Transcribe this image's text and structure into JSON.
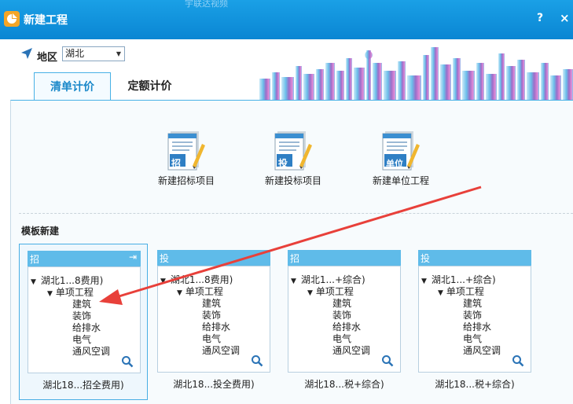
{
  "window": {
    "background_text": "宇联达视频",
    "title": "新建工程",
    "help": "?",
    "close": "×"
  },
  "region": {
    "label": "地区",
    "value": "湖北"
  },
  "tabs": [
    {
      "label": "清单计价",
      "active": true
    },
    {
      "label": "定额计价",
      "active": false
    }
  ],
  "actions": [
    {
      "badge": "招",
      "label": "新建招标项目",
      "icon": "bid-document-icon"
    },
    {
      "badge": "投",
      "label": "新建投标项目",
      "icon": "tender-document-icon"
    },
    {
      "badge": "单位",
      "label": "新建单位工程",
      "icon": "unit-document-icon"
    }
  ],
  "templates": {
    "title": "模板新建",
    "cards": [
      {
        "tag": "招",
        "root": "湖北1...8费用)",
        "sub": "单项工程",
        "items": [
          "建筑",
          "装饰",
          "给排水",
          "电气",
          "通风空调"
        ],
        "name": "湖北18...招全费用)"
      },
      {
        "tag": "投",
        "root": "湖北1...8费用)",
        "sub": "单项工程",
        "items": [
          "建筑",
          "装饰",
          "给排水",
          "电气",
          "通风空调"
        ],
        "name": "湖北18...投全费用)"
      },
      {
        "tag": "招",
        "root": "湖北1...+综合)",
        "sub": "单项工程",
        "items": [
          "建筑",
          "装饰",
          "给排水",
          "电气",
          "通风空调"
        ],
        "name": "湖北18...税+综合)"
      },
      {
        "tag": "投",
        "root": "湖北1...+综合)",
        "sub": "单项工程",
        "items": [
          "建筑",
          "装饰",
          "给排水",
          "电气",
          "通风空调"
        ],
        "name": "湖北18...税+综合)"
      }
    ]
  },
  "colors": {
    "titlebar": "#0a86d3",
    "accent": "#48b1e6",
    "arrow": "#e8403a"
  }
}
